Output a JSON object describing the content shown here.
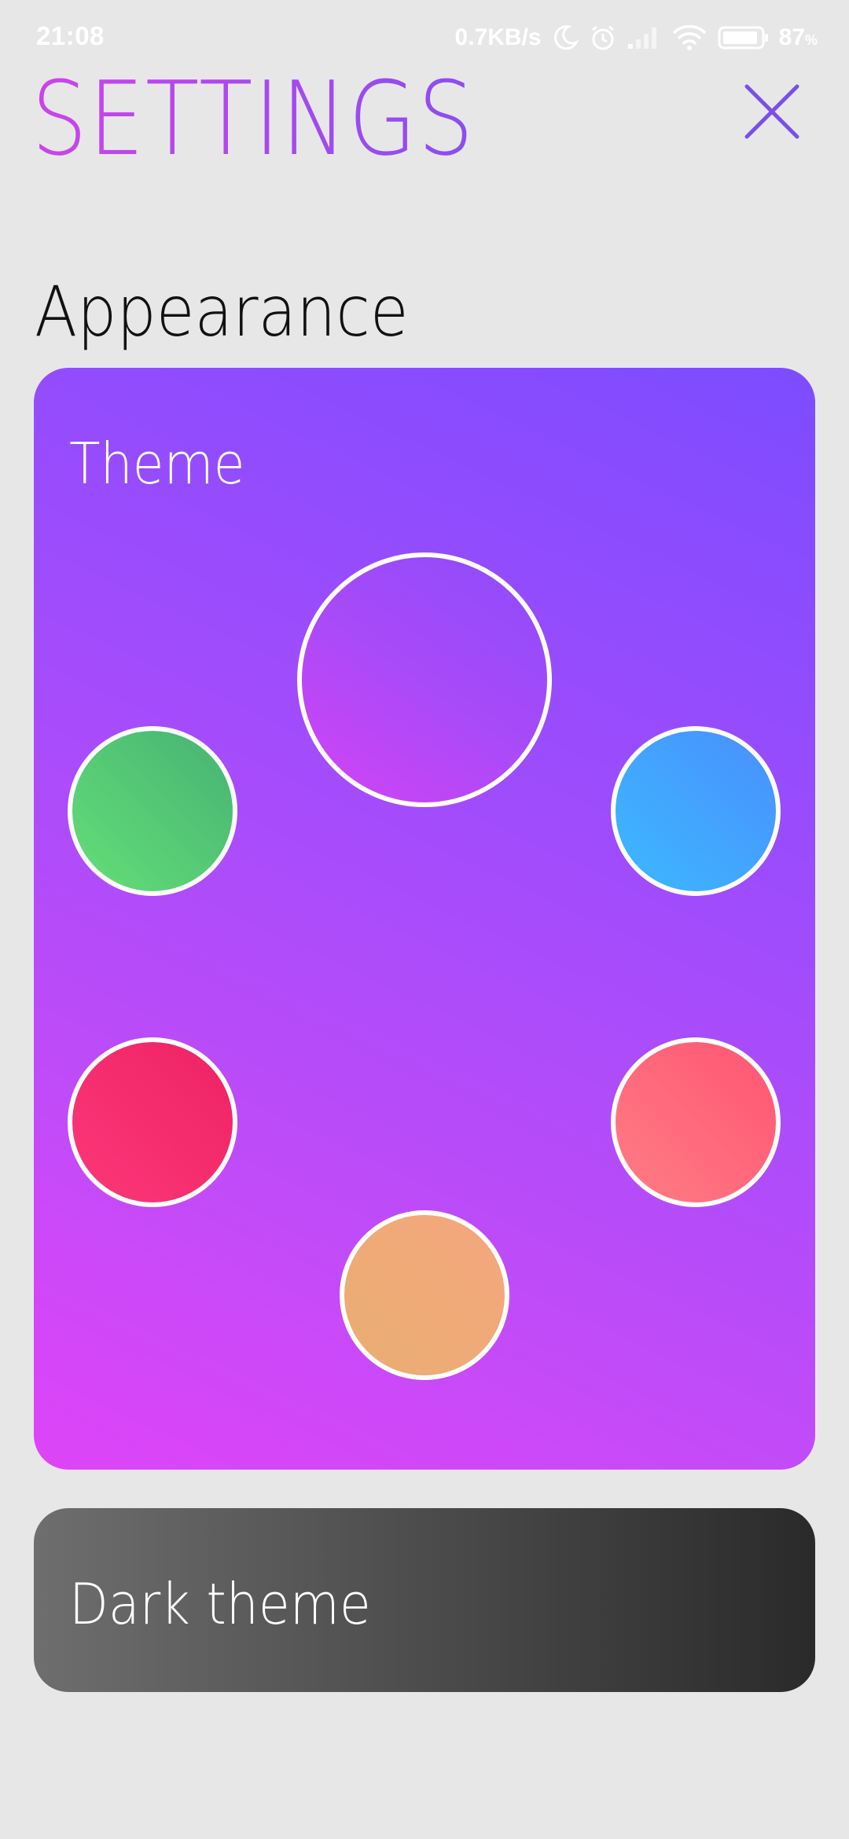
{
  "status_bar": {
    "time": "21:08",
    "net_speed": "0.7KB/s",
    "battery_percent": "87",
    "battery_unit": "%",
    "battery_level": 0.87,
    "icons": [
      "moon-icon",
      "alarm-icon",
      "signal-icon",
      "wifi-icon",
      "battery-icon"
    ]
  },
  "header": {
    "title": "SETTINGS",
    "close_icon": "close-icon",
    "accent_start": "#cc44ea",
    "accent_end": "#8a4ef0"
  },
  "appearance": {
    "heading": "Appearance",
    "theme_card": {
      "title": "Theme",
      "swatches": [
        {
          "name": "purple",
          "color": "#b047f8",
          "selected": true
        },
        {
          "name": "green",
          "color": "#56c775"
        },
        {
          "name": "blue",
          "color": "#43a3fe"
        },
        {
          "name": "red",
          "color": "#f42c6f"
        },
        {
          "name": "coral",
          "color": "#ff6a7c"
        },
        {
          "name": "peach",
          "color": "#efa979"
        }
      ]
    },
    "dark_theme": {
      "label": "Dark theme"
    }
  }
}
